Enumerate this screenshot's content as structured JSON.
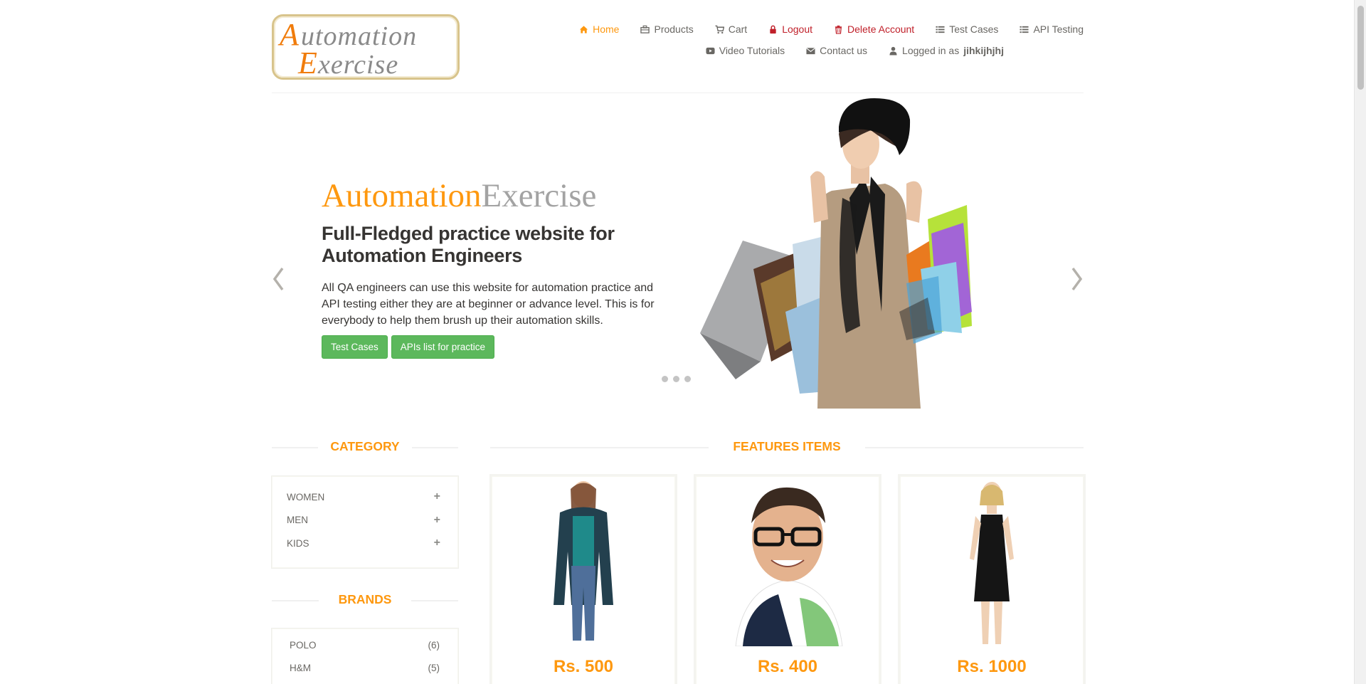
{
  "header": {
    "logo_line1": "Automation",
    "logo_line2": "Exercise",
    "nav": {
      "home": "Home",
      "products": "Products",
      "cart": "Cart",
      "logout": "Logout",
      "delete_account": "Delete Account",
      "test_cases": "Test Cases",
      "api_testing": "API Testing",
      "video_tutorials": "Video Tutorials",
      "contact_us": "Contact us",
      "logged_in_prefix": "Logged in as",
      "username": "jihkijhjhj"
    }
  },
  "slider": {
    "brand_orange": "Automation",
    "brand_gray": "Exercise",
    "heading": "Full-Fledged practice website for Automation Engineers",
    "paragraph": "All QA engineers can use this website for automation practice and API testing either they are at beginner or advance level. This is for everybody to help them brush up their automation skills.",
    "btn_test_cases": "Test Cases",
    "btn_apis": "APIs list for practice",
    "dots_count": 3
  },
  "sidebar": {
    "category_title": "CATEGORY",
    "categories": [
      {
        "label": "WOMEN",
        "icon": "plus-icon"
      },
      {
        "label": "MEN",
        "icon": "plus-icon"
      },
      {
        "label": "KIDS",
        "icon": "plus-icon"
      }
    ],
    "brands_title": "BRANDS",
    "brands": [
      {
        "label": "POLO",
        "count": "(6)"
      },
      {
        "label": "H&M",
        "count": "(5)"
      }
    ]
  },
  "features": {
    "title": "FEATURES ITEMS",
    "products": [
      {
        "price": "Rs. 500"
      },
      {
        "price": "Rs. 400"
      },
      {
        "price": "Rs. 1000"
      }
    ]
  },
  "colors": {
    "accent": "#fe980f",
    "danger": "#c0202a",
    "button_green": "#5cb85c",
    "text": "#696763"
  }
}
